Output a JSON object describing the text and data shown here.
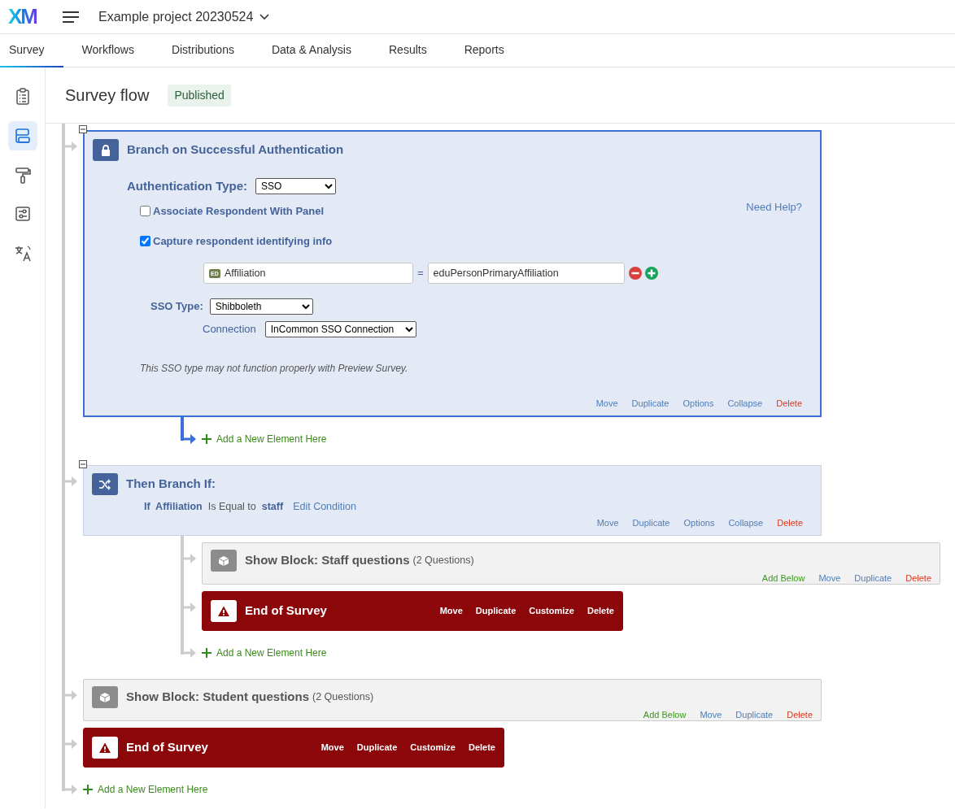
{
  "header": {
    "logo": "XM",
    "project": "Example project 20230524"
  },
  "tabs": [
    {
      "label": "Survey",
      "selected": true
    },
    {
      "label": "Workflows",
      "selected": false
    },
    {
      "label": "Distributions",
      "selected": false
    },
    {
      "label": "Data & Analysis",
      "selected": false
    },
    {
      "label": "Results",
      "selected": false
    },
    {
      "label": "Reports",
      "selected": false
    }
  ],
  "sidebar": {
    "items": [
      {
        "kind": "clipboard",
        "selected": false
      },
      {
        "kind": "flow",
        "selected": true
      },
      {
        "kind": "paint",
        "selected": false
      },
      {
        "kind": "options",
        "selected": false
      },
      {
        "kind": "translate",
        "selected": false
      }
    ]
  },
  "page": {
    "title": "Survey flow",
    "status": "Published"
  },
  "flow": [
    {
      "kind": "authentication",
      "selected": true,
      "expanded": true,
      "title": "Branch on Successful Authentication",
      "auth_type": {
        "label": "Authentication Type:",
        "value": "SSO"
      },
      "help_link": "Need Help?",
      "checkboxes": [
        {
          "label": "Associate Respondent With Panel",
          "checked": false
        },
        {
          "label": "Capture respondent identifying info",
          "checked": true
        }
      ],
      "mapping": {
        "field_tag": "ED",
        "field": "Affiliation",
        "operator": "=",
        "value": "eduPersonPrimaryAffiliation"
      },
      "sso_type": {
        "label": "SSO Type:",
        "value": "Shibboleth"
      },
      "connection": {
        "label": "Connection",
        "value": "InCommon SSO Connection"
      },
      "note": "This SSO type may not function properly with Preview Survey.",
      "actions": [
        {
          "label": "Move",
          "kind": "normal"
        },
        {
          "label": "Duplicate",
          "kind": "normal"
        },
        {
          "label": "Options",
          "kind": "normal"
        },
        {
          "label": "Collapse",
          "kind": "normal"
        },
        {
          "label": "Delete",
          "kind": "danger"
        }
      ],
      "children": [
        {
          "kind": "add",
          "label": "Add a New Element Here"
        }
      ]
    },
    {
      "kind": "branch",
      "selected": false,
      "expanded": true,
      "title": "Then Branch If:",
      "condition": "**If  Affiliation**  Is Equal to  **staff**",
      "edit_link": "Edit Condition",
      "actions": [
        {
          "label": "Move",
          "kind": "normal"
        },
        {
          "label": "Duplicate",
          "kind": "normal"
        },
        {
          "label": "Options",
          "kind": "normal"
        },
        {
          "label": "Collapse",
          "kind": "normal"
        },
        {
          "label": "Delete",
          "kind": "danger"
        }
      ],
      "children": [
        {
          "kind": "block",
          "selected": false,
          "title": "Show Block: Staff questions",
          "count": "(2 Questions)",
          "actions": [
            {
              "label": "Add Below",
              "kind": "add"
            },
            {
              "label": "Move",
              "kind": "normal"
            },
            {
              "label": "Duplicate",
              "kind": "normal"
            },
            {
              "label": "Delete",
              "kind": "danger"
            }
          ]
        },
        {
          "kind": "end",
          "selected": false,
          "title": "End of Survey",
          "actions": [
            {
              "label": "Move"
            },
            {
              "label": "Duplicate"
            },
            {
              "label": "Customize"
            },
            {
              "label": "Delete"
            }
          ]
        },
        {
          "kind": "add",
          "label": "Add a New Element Here"
        }
      ]
    },
    {
      "kind": "block",
      "selected": false,
      "title": "Show Block: Student questions",
      "count": "(2 Questions)",
      "actions": [
        {
          "label": "Add Below",
          "kind": "add"
        },
        {
          "label": "Move",
          "kind": "normal"
        },
        {
          "label": "Duplicate",
          "kind": "normal"
        },
        {
          "label": "Delete",
          "kind": "danger"
        }
      ]
    },
    {
      "kind": "end",
      "selected": false,
      "title": "End of Survey",
      "actions": [
        {
          "label": "Move"
        },
        {
          "label": "Duplicate"
        },
        {
          "label": "Customize"
        },
        {
          "label": "Delete"
        }
      ]
    },
    {
      "kind": "add",
      "label": "Add a New Element Here"
    }
  ]
}
